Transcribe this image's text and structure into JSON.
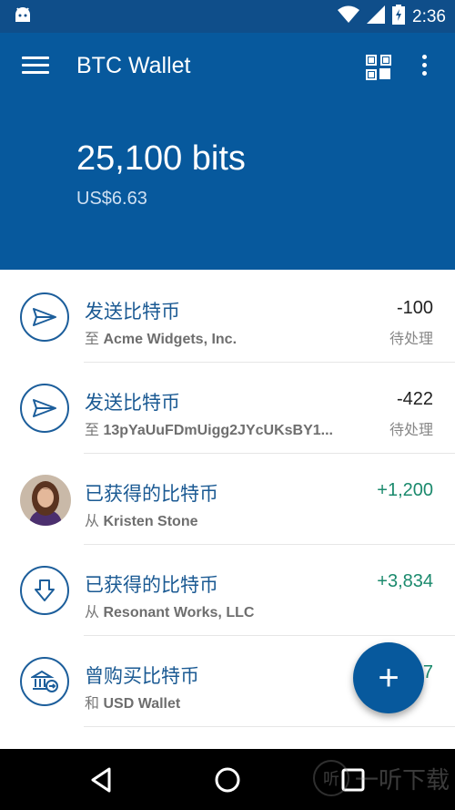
{
  "status_bar": {
    "time": "2:36",
    "notification_icon": "android-icon",
    "wifi_icon": "wifi-icon",
    "signal_icon": "signal-icon",
    "battery_icon": "battery-charging-icon"
  },
  "toolbar": {
    "title": "BTC Wallet",
    "menu_icon": "hamburger-icon",
    "qr_icon": "qr-code-icon",
    "more_icon": "more-vert-icon"
  },
  "balance": {
    "amount": "25,100 bits",
    "fiat": "US$6.63"
  },
  "transactions": [
    {
      "title": "发送比特币",
      "prefix": "至",
      "party": "Acme Widgets, Inc.",
      "amount": "-100",
      "status": "待处理",
      "icon": "send-icon"
    },
    {
      "title": "发送比特币",
      "prefix": "至",
      "party": "13pYaUuFDmUigg2JYcUKsBY1...",
      "amount": "-422",
      "status": "待处理",
      "icon": "send-icon"
    },
    {
      "title": "已获得的比特币",
      "prefix": "从",
      "party": "Kristen Stone",
      "amount": "+1,200",
      "status": "",
      "icon": "contact-photo"
    },
    {
      "title": "已获得的比特币",
      "prefix": "从",
      "party": "Resonant Works, LLC",
      "amount": "+3,834",
      "status": "",
      "icon": "receive-icon"
    },
    {
      "title": "曾购买比特币",
      "prefix": "和",
      "party": "USD Wallet",
      "amount": "7",
      "status": "",
      "icon": "bank-transfer-icon"
    }
  ],
  "fab": {
    "label": "+",
    "icon": "plus-icon"
  },
  "nav_bar": {
    "back_icon": "back-triangle-icon",
    "home_icon": "home-circle-icon",
    "recents_icon": "recents-square-icon"
  },
  "watermark": {
    "glyph": "听",
    "text": "一听下载"
  },
  "colors": {
    "primary": "#07599d",
    "positive": "#1b8a6d",
    "text_title": "#1b5a93"
  }
}
